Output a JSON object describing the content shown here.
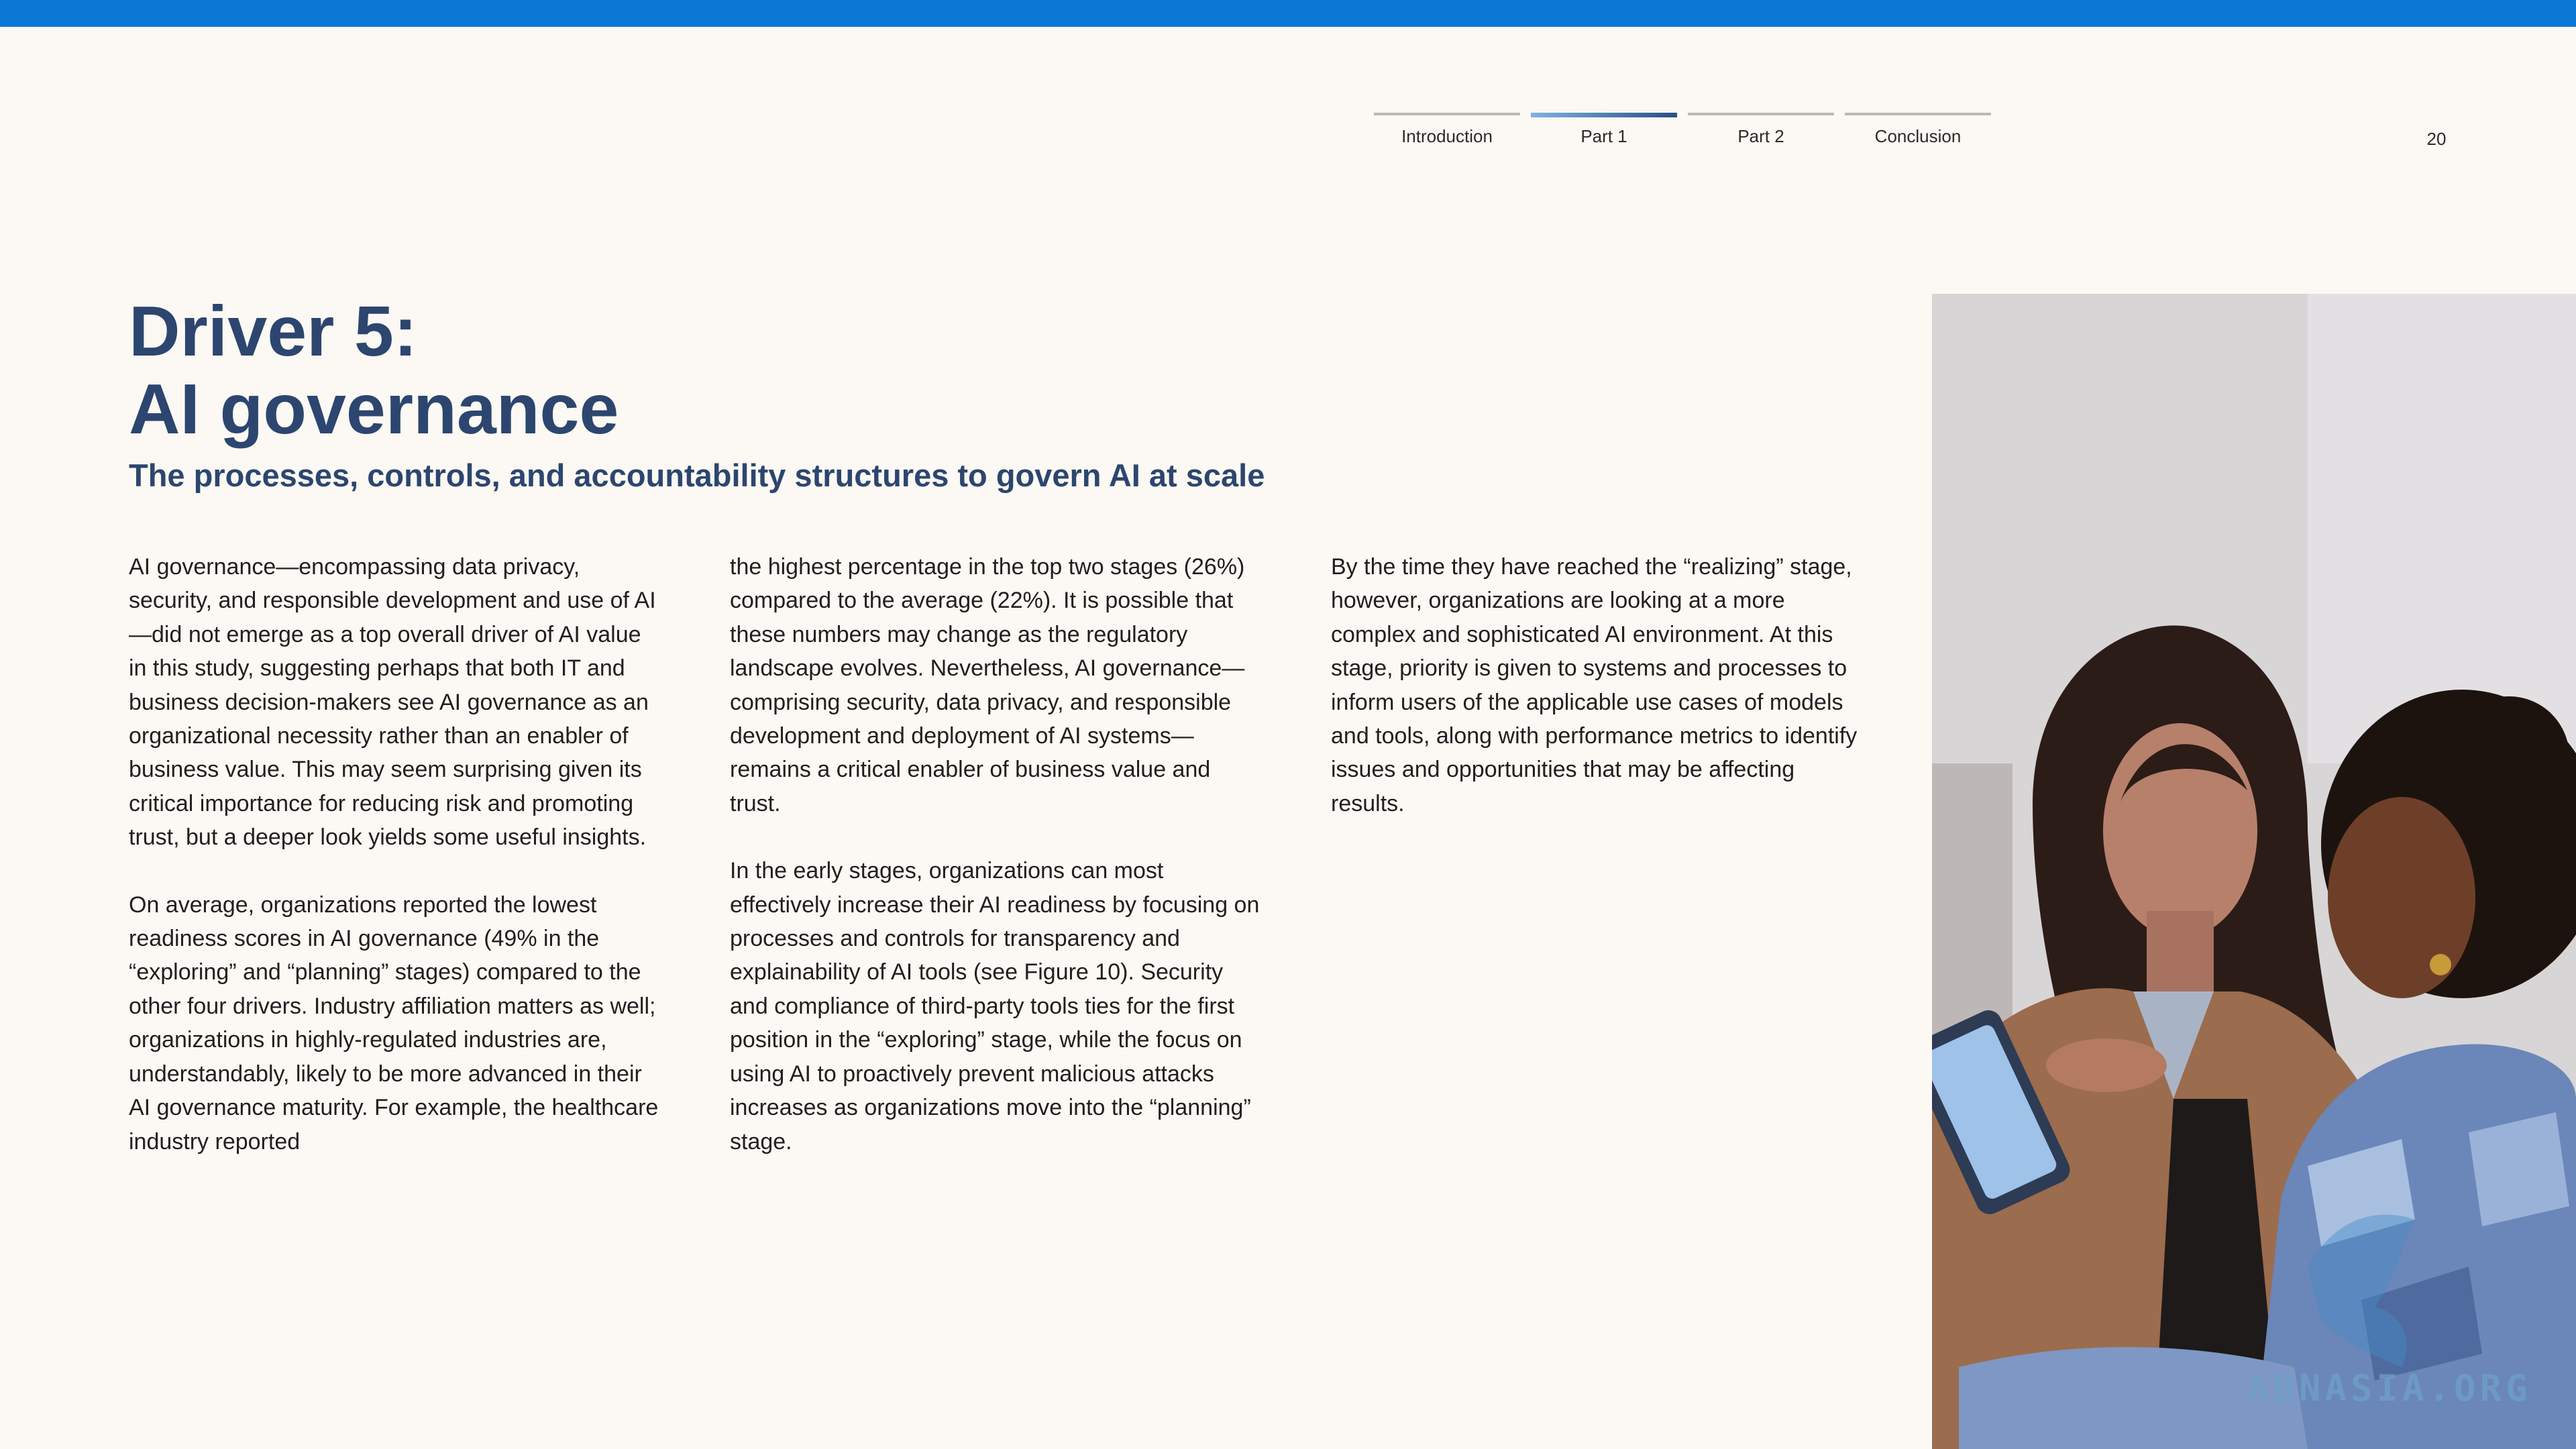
{
  "nav": {
    "tabs": [
      {
        "label": "Introduction",
        "active": false
      },
      {
        "label": "Part 1",
        "active": true
      },
      {
        "label": "Part 2",
        "active": false
      },
      {
        "label": "Conclusion",
        "active": false
      }
    ]
  },
  "page_number": "20",
  "heading": {
    "title_line1": "Driver 5:",
    "title_line2": "AI governance",
    "subtitle": "The processes, controls, and accountability structures to govern AI at scale"
  },
  "columns": [
    {
      "paragraphs": [
        "AI governance—encompassing data privacy, security, and responsible development and use of AI—did not emerge as a top overall driver of AI value in this study, suggesting perhaps that both IT and business decision-makers see AI governance as an organizational necessity rather than an enabler of business value. This may seem surprising given its critical importance for reducing risk and promoting trust, but a deeper look yields some useful insights.",
        "On average, organizations reported the lowest readiness scores in AI governance (49% in the “exploring” and “planning” stages) compared to the other four drivers. Industry affiliation matters as well; organizations in highly-regulated industries are, understandably, likely to be more advanced in their AI governance maturity. For example, the healthcare industry reported"
      ]
    },
    {
      "paragraphs": [
        "the highest percentage in the top two stages (26%) compared to the average (22%). It is possible that these numbers may change as the regulatory landscape evolves. Nevertheless, AI governance—comprising security, data privacy, and responsible development and deployment of AI systems—remains a critical enabler of business value and trust.",
        "In the early stages, organizations can most effectively increase their AI readiness by focusing on processes and controls for transparency and explainability of AI tools (see Figure 10). Security and compliance of third-party tools ties for the first position in the “exploring” stage, while the focus on using AI to proactively prevent malicious attacks increases as organizations move into the “planning” stage."
      ]
    },
    {
      "paragraphs": [
        "By the time they have reached the “realizing” stage, however, organizations are looking at a more complex and sophisticated AI environment. At this stage, priority is given to systems and processes to inform users of the applicable use cases of models and tools, along with performance metrics to identify issues and opportunities that may be affecting results."
      ]
    }
  ],
  "photo": {
    "watermark": "ABNASIA.ORG"
  },
  "colors": {
    "accent_bar": "#0a78d4",
    "heading": "#2c466f",
    "background": "#fcf8f3"
  }
}
